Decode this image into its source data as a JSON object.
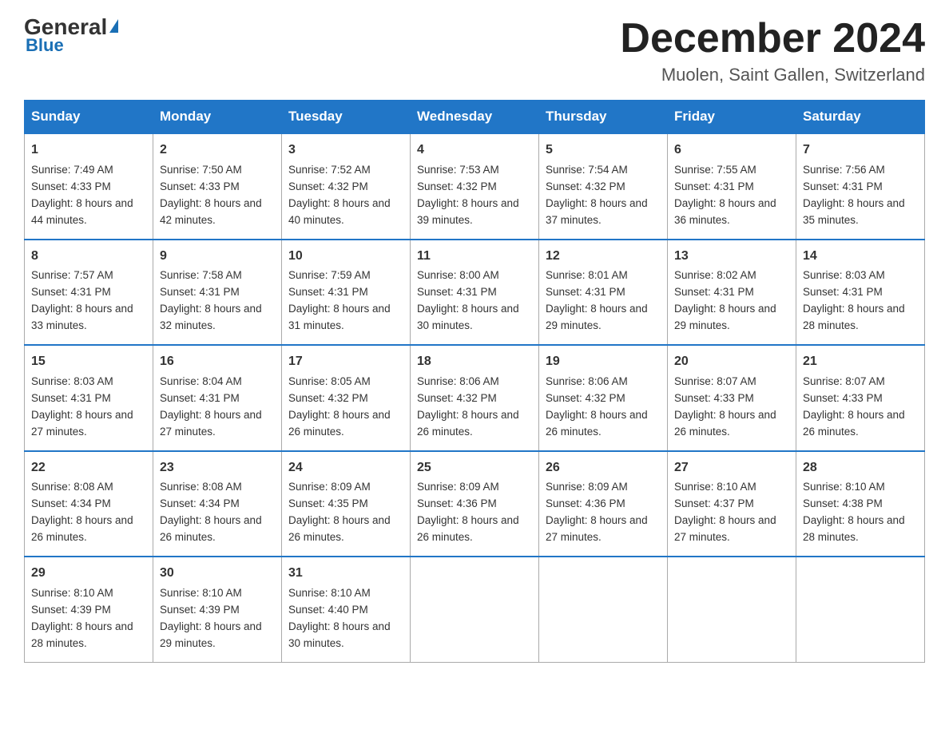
{
  "logo": {
    "name_black": "General",
    "name_blue": "Blue"
  },
  "title": {
    "month_year": "December 2024",
    "location": "Muolen, Saint Gallen, Switzerland"
  },
  "days_header": [
    "Sunday",
    "Monday",
    "Tuesday",
    "Wednesday",
    "Thursday",
    "Friday",
    "Saturday"
  ],
  "weeks": [
    [
      {
        "day": "1",
        "sunrise": "7:49 AM",
        "sunset": "4:33 PM",
        "daylight": "8 hours and 44 minutes."
      },
      {
        "day": "2",
        "sunrise": "7:50 AM",
        "sunset": "4:33 PM",
        "daylight": "8 hours and 42 minutes."
      },
      {
        "day": "3",
        "sunrise": "7:52 AM",
        "sunset": "4:32 PM",
        "daylight": "8 hours and 40 minutes."
      },
      {
        "day": "4",
        "sunrise": "7:53 AM",
        "sunset": "4:32 PM",
        "daylight": "8 hours and 39 minutes."
      },
      {
        "day": "5",
        "sunrise": "7:54 AM",
        "sunset": "4:32 PM",
        "daylight": "8 hours and 37 minutes."
      },
      {
        "day": "6",
        "sunrise": "7:55 AM",
        "sunset": "4:31 PM",
        "daylight": "8 hours and 36 minutes."
      },
      {
        "day": "7",
        "sunrise": "7:56 AM",
        "sunset": "4:31 PM",
        "daylight": "8 hours and 35 minutes."
      }
    ],
    [
      {
        "day": "8",
        "sunrise": "7:57 AM",
        "sunset": "4:31 PM",
        "daylight": "8 hours and 33 minutes."
      },
      {
        "day": "9",
        "sunrise": "7:58 AM",
        "sunset": "4:31 PM",
        "daylight": "8 hours and 32 minutes."
      },
      {
        "day": "10",
        "sunrise": "7:59 AM",
        "sunset": "4:31 PM",
        "daylight": "8 hours and 31 minutes."
      },
      {
        "day": "11",
        "sunrise": "8:00 AM",
        "sunset": "4:31 PM",
        "daylight": "8 hours and 30 minutes."
      },
      {
        "day": "12",
        "sunrise": "8:01 AM",
        "sunset": "4:31 PM",
        "daylight": "8 hours and 29 minutes."
      },
      {
        "day": "13",
        "sunrise": "8:02 AM",
        "sunset": "4:31 PM",
        "daylight": "8 hours and 29 minutes."
      },
      {
        "day": "14",
        "sunrise": "8:03 AM",
        "sunset": "4:31 PM",
        "daylight": "8 hours and 28 minutes."
      }
    ],
    [
      {
        "day": "15",
        "sunrise": "8:03 AM",
        "sunset": "4:31 PM",
        "daylight": "8 hours and 27 minutes."
      },
      {
        "day": "16",
        "sunrise": "8:04 AM",
        "sunset": "4:31 PM",
        "daylight": "8 hours and 27 minutes."
      },
      {
        "day": "17",
        "sunrise": "8:05 AM",
        "sunset": "4:32 PM",
        "daylight": "8 hours and 26 minutes."
      },
      {
        "day": "18",
        "sunrise": "8:06 AM",
        "sunset": "4:32 PM",
        "daylight": "8 hours and 26 minutes."
      },
      {
        "day": "19",
        "sunrise": "8:06 AM",
        "sunset": "4:32 PM",
        "daylight": "8 hours and 26 minutes."
      },
      {
        "day": "20",
        "sunrise": "8:07 AM",
        "sunset": "4:33 PM",
        "daylight": "8 hours and 26 minutes."
      },
      {
        "day": "21",
        "sunrise": "8:07 AM",
        "sunset": "4:33 PM",
        "daylight": "8 hours and 26 minutes."
      }
    ],
    [
      {
        "day": "22",
        "sunrise": "8:08 AM",
        "sunset": "4:34 PM",
        "daylight": "8 hours and 26 minutes."
      },
      {
        "day": "23",
        "sunrise": "8:08 AM",
        "sunset": "4:34 PM",
        "daylight": "8 hours and 26 minutes."
      },
      {
        "day": "24",
        "sunrise": "8:09 AM",
        "sunset": "4:35 PM",
        "daylight": "8 hours and 26 minutes."
      },
      {
        "day": "25",
        "sunrise": "8:09 AM",
        "sunset": "4:36 PM",
        "daylight": "8 hours and 26 minutes."
      },
      {
        "day": "26",
        "sunrise": "8:09 AM",
        "sunset": "4:36 PM",
        "daylight": "8 hours and 27 minutes."
      },
      {
        "day": "27",
        "sunrise": "8:10 AM",
        "sunset": "4:37 PM",
        "daylight": "8 hours and 27 minutes."
      },
      {
        "day": "28",
        "sunrise": "8:10 AM",
        "sunset": "4:38 PM",
        "daylight": "8 hours and 28 minutes."
      }
    ],
    [
      {
        "day": "29",
        "sunrise": "8:10 AM",
        "sunset": "4:39 PM",
        "daylight": "8 hours and 28 minutes."
      },
      {
        "day": "30",
        "sunrise": "8:10 AM",
        "sunset": "4:39 PM",
        "daylight": "8 hours and 29 minutes."
      },
      {
        "day": "31",
        "sunrise": "8:10 AM",
        "sunset": "4:40 PM",
        "daylight": "8 hours and 30 minutes."
      },
      null,
      null,
      null,
      null
    ]
  ]
}
